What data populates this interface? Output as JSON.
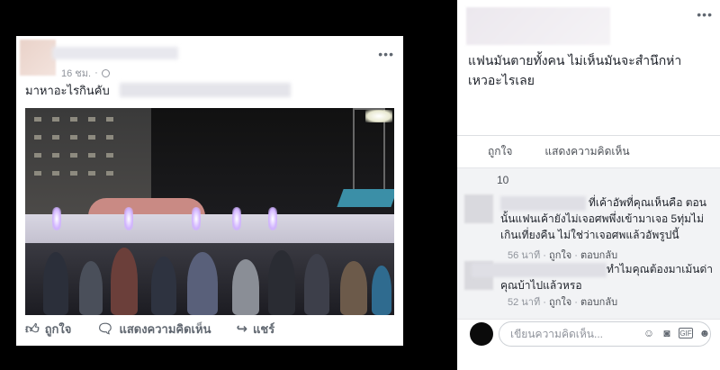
{
  "post": {
    "time": "16 ชม.",
    "text": "มาหาอะไรกินคับ",
    "actions": {
      "like": "ถูกใจ",
      "comment": "แสดงความคิดเห็น",
      "share": "แชร์"
    }
  },
  "panel": {
    "caption": "แฟนมันตายทั้งคน ไม่เห็นมันจะสำนึกห่าเหวอะไรเลย",
    "actions": {
      "like": "ถูกใจ",
      "comment": "แสดงความคิดเห็น"
    },
    "reaction_count": "10",
    "comments": [
      {
        "text": "ที่เค้าอัพที่คุณเห็นคือ ตอนนั้นแฟนเค้ายังไม่เจอศพพึ่งเข้ามาเจอ 5ทุ่มไม่เกินเที่ยงคืน ไม่ใช่ว่าเจอศพแล้วอัพรูปนี้",
        "time": "56 นาที",
        "like": "ถูกใจ",
        "reply": "ตอบกลับ"
      },
      {
        "text": "ทำไมคุณต้องมาเม้นด่าคุณบ้าไปแล้วหรอ",
        "time": "52 นาที",
        "like": "ถูกใจ",
        "reply": "ตอบกลับ"
      }
    ],
    "write_placeholder": "เขียนความคิดเห็น..."
  },
  "icons": [
    "more-icon",
    "globe-icon",
    "like-icon",
    "comment-icon",
    "share-icon",
    "emoji-icon",
    "camera-icon",
    "gif-icon",
    "sticker-icon"
  ]
}
